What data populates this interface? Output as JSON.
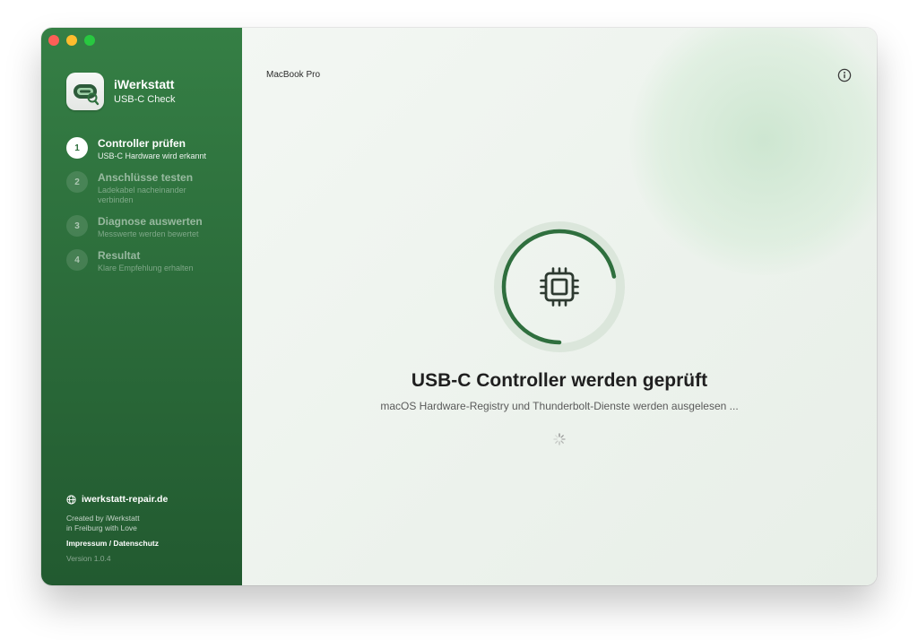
{
  "app": {
    "name": "iWerkstatt",
    "subtitle": "USB-C Check"
  },
  "steps": [
    {
      "number": "1",
      "title": "Controller prüfen",
      "description": "USB-C Hardware wird erkannt",
      "active": true
    },
    {
      "number": "2",
      "title": "Anschlüsse testen",
      "description": "Ladekabel nacheinander verbinden",
      "active": false
    },
    {
      "number": "3",
      "title": "Diagnose auswerten",
      "description": "Messwerte werden bewertet",
      "active": false
    },
    {
      "number": "4",
      "title": "Resultat",
      "description": "Klare Empfehlung erhalten",
      "active": false
    }
  ],
  "footer": {
    "website": "iwerkstatt-repair.de",
    "credit_line1": "Created by iWerkstatt",
    "credit_line2": "in Freiburg with Love",
    "legal": "Impressum / Datenschutz",
    "version": "Version 1.0.4"
  },
  "main": {
    "device": "MacBook Pro",
    "status_title": "USB-C Controller werden geprüft",
    "status_subtitle": "macOS Hardware-Registry und Thunderbolt-Dienste werden ausgelesen ...",
    "progress": 0.72
  },
  "icons": {
    "main": "cpu-chip-icon",
    "info": "info-icon",
    "website": "globe-icon",
    "app": "usb-c-port-icon"
  },
  "colors": {
    "accent": "#2f6f3e",
    "sidebar": "#2c6d3b",
    "ring_track": "#d6e3d6"
  }
}
